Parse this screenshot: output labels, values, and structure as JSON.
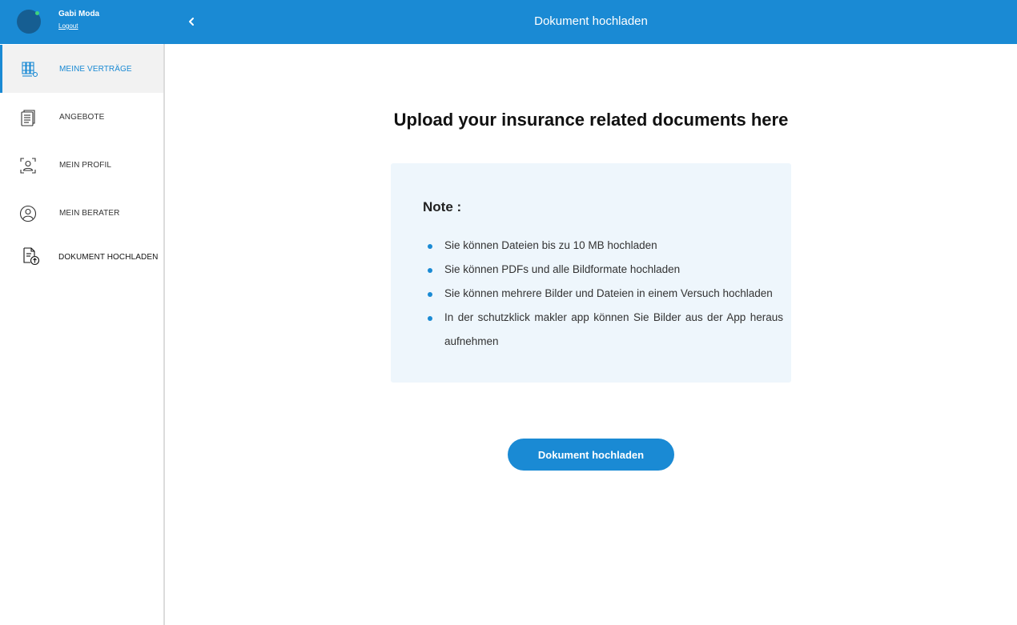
{
  "user": {
    "name": "Gabi Moda",
    "logout_label": "Logout"
  },
  "header": {
    "title": "Dokument hochladen",
    "back_icon": "chevron-left-icon"
  },
  "sidebar": {
    "items": [
      {
        "label": "MEINE VERTRÄGE",
        "icon": "contracts-icon",
        "active": true
      },
      {
        "label": "ANGEBOTE",
        "icon": "document-icon",
        "active": false
      },
      {
        "label": "MEIN PROFIL",
        "icon": "profile-icon",
        "active": false
      },
      {
        "label": "MEIN BERATER",
        "icon": "advisor-icon",
        "active": false
      },
      {
        "label": "DOKUMENT HOCHLADEN",
        "icon": "upload-document-icon",
        "active": false
      }
    ]
  },
  "main": {
    "title": "Upload your insurance related documents here",
    "note": {
      "title": "Note :",
      "items": [
        "Sie können Dateien bis zu 10 MB hochladen",
        "Sie können PDFs und alle Bildformate hochladen",
        "Sie können mehrere Bilder und Dateien in einem Versuch hochladen",
        "In der schutzklick makler app können Sie Bilder aus der App heraus aufnehmen"
      ]
    },
    "upload_button_label": "Dokument hochladen"
  },
  "colors": {
    "accent": "#1a8ad4",
    "note_background": "#eef6fc",
    "status_online": "#3fd27d"
  }
}
